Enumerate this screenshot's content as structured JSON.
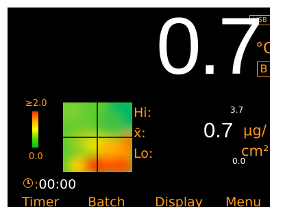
{
  "status": {
    "usb_label": "USB"
  },
  "reading": {
    "value": "0.7",
    "temp_unit": "°C",
    "mode_badge": "B"
  },
  "heatmap": {
    "scale_max": "≥2.0",
    "scale_min": "0.0",
    "colorbar_stops": [
      "#ff2a00",
      "#ffaa00",
      "#ffff00",
      "#55dd00",
      "#00c020"
    ]
  },
  "stats": {
    "hi_label": "Hi:",
    "avg_label": "x̄:",
    "lo_label": "Lo:",
    "hi_value": "3.7",
    "avg_value": "0.7",
    "lo_value": "0.0",
    "unit_top": "μg/",
    "unit_bottom": "cm²"
  },
  "timer": {
    "time": "00:00"
  },
  "softkeys": {
    "timer": "Timer",
    "batch": "Batch",
    "display": "Display",
    "menu": "Menu"
  },
  "colors": {
    "accent": "#ff9a1a",
    "background": "#000000",
    "text": "#ffffff"
  }
}
